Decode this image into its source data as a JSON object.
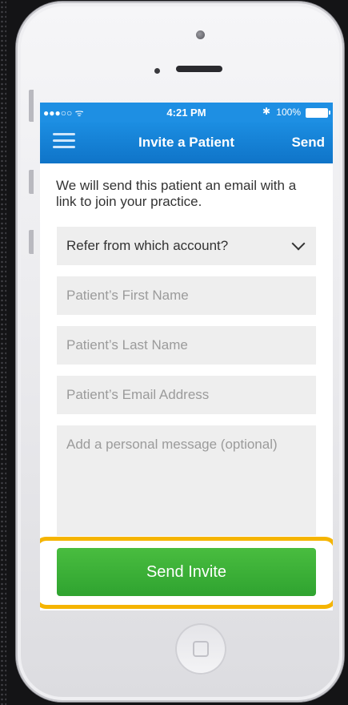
{
  "status_bar": {
    "signal": "●●●○○ ᯤ",
    "time": "4:21 PM",
    "bluetooth_icon": "bluetooth-icon",
    "battery_text": "100%",
    "battery_level": 1.0
  },
  "nav": {
    "menu_icon": "hamburger-menu-icon",
    "title": "Invite a Patient",
    "send_label": "Send",
    "color": "#1783d6"
  },
  "form": {
    "intro_text": "We will send this patient an email with a link to join your practice.",
    "account_select": {
      "value": "Refer from which account?"
    },
    "first_name": {
      "placeholder": "Patient’s First Name"
    },
    "last_name": {
      "placeholder": "Patient’s Last Name"
    },
    "email": {
      "placeholder": "Patient’s Email Address"
    },
    "message": {
      "placeholder": "Add a personal message (optional)"
    },
    "submit_label": "Send Invite",
    "submit_color": "#3cb038",
    "highlight_color": "#f5b400"
  }
}
